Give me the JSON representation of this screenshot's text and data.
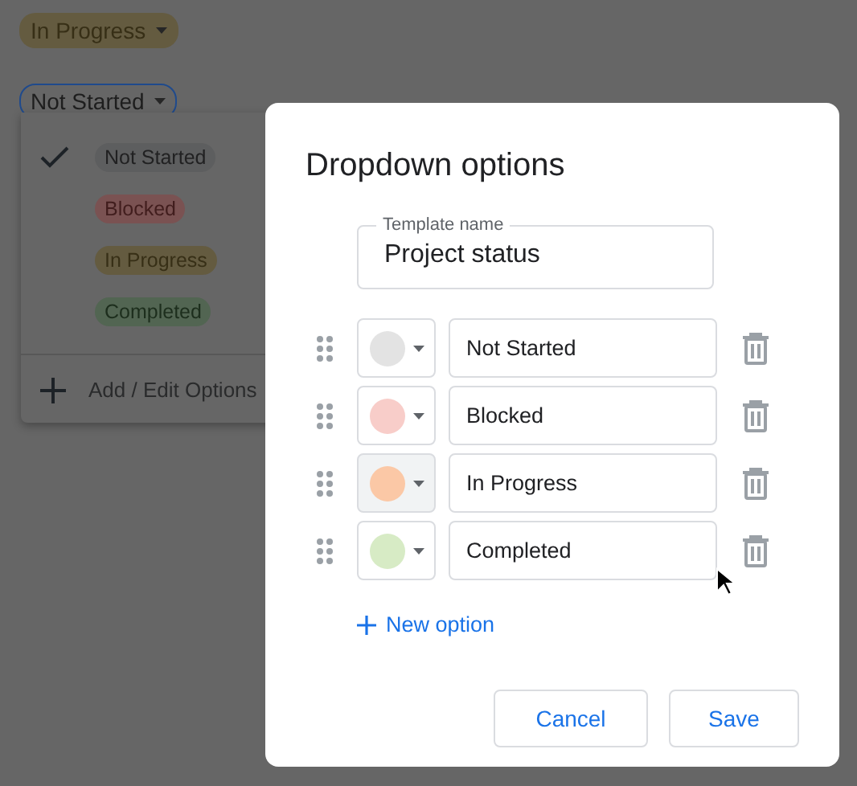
{
  "sheet": {
    "cells": [
      {
        "label": "In Progress",
        "color": "#645b40",
        "selected": false
      },
      {
        "label": "Not Started",
        "selected": true
      }
    ]
  },
  "menu": {
    "items": [
      {
        "label": "Not Started",
        "color": "#5d5e5f",
        "checked": true
      },
      {
        "label": "Blocked",
        "color": "#7a5252",
        "checked": false
      },
      {
        "label": "In Progress",
        "color": "#645b40",
        "checked": false
      },
      {
        "label": "Completed",
        "color": "#526552",
        "checked": false
      }
    ],
    "action": "Add / Edit Options"
  },
  "dialog": {
    "title": "Dropdown options",
    "template_field": {
      "label": "Template name",
      "value": "Project status"
    },
    "options": [
      {
        "label": "Not Started",
        "color": "#e3e3e3",
        "hovered": false
      },
      {
        "label": "Blocked",
        "color": "#f8cdc9",
        "hovered": false
      },
      {
        "label": "In Progress",
        "color": "#fbc8a6",
        "hovered": true
      },
      {
        "label": "Completed",
        "color": "#d7ebc5",
        "hovered": false
      }
    ],
    "new_option": "New option",
    "buttons": [
      {
        "label": "Cancel"
      },
      {
        "label": "Save"
      }
    ]
  }
}
